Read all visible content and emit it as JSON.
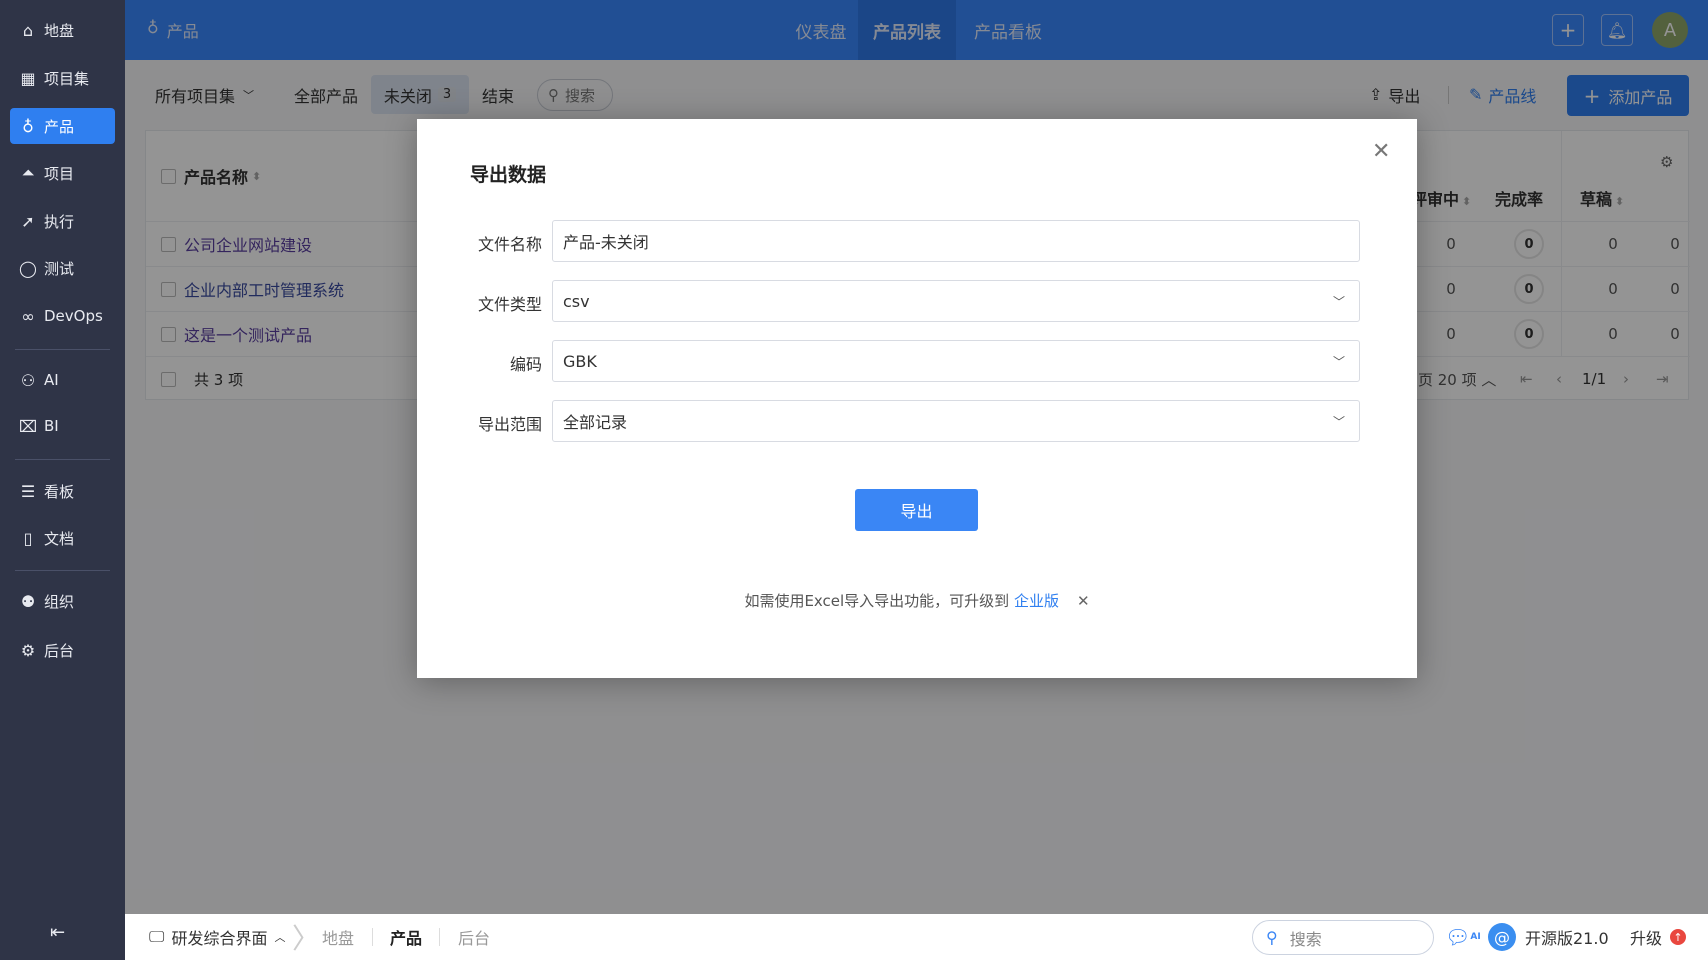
{
  "sidebar": {
    "items": [
      {
        "label": "地盘",
        "icon": "home-icon"
      },
      {
        "label": "项目集",
        "icon": "grid-icon"
      },
      {
        "label": "产品",
        "icon": "lightbulb-icon",
        "active": true
      },
      {
        "label": "项目",
        "icon": "rocket-icon"
      },
      {
        "label": "执行",
        "icon": "run-icon"
      },
      {
        "label": "测试",
        "icon": "test-icon"
      },
      {
        "label": "DevOps",
        "icon": "infinity-icon"
      },
      {
        "label": "AI",
        "icon": "robot-icon"
      },
      {
        "label": "BI",
        "icon": "chart-board-icon"
      },
      {
        "label": "看板",
        "icon": "kanban-icon"
      },
      {
        "label": "文档",
        "icon": "document-icon"
      },
      {
        "label": "组织",
        "icon": "users-icon"
      },
      {
        "label": "后台",
        "icon": "gear-icon"
      }
    ]
  },
  "topbar": {
    "breadcrumb": "产品",
    "nav": [
      {
        "label": "仪表盘"
      },
      {
        "label": "产品列表",
        "active": true
      },
      {
        "label": "产品看板"
      }
    ],
    "avatar": "A",
    "accent": "#3a88ff"
  },
  "toolbar": {
    "program_filter": "所有项目集",
    "tabs": [
      {
        "label": "全部产品"
      },
      {
        "label": "未关闭",
        "count": "3",
        "active": true
      },
      {
        "label": "结束"
      }
    ],
    "search": "搜索",
    "export": "导出",
    "product_line": "产品线",
    "add_product": "添加产品"
  },
  "table": {
    "headers": {
      "name": "产品名称",
      "reviewing": "评审中",
      "completion": "完成率",
      "draft": "草稿"
    },
    "rows": [
      {
        "name": "公司企业网站建设",
        "reviewing": "0",
        "completion": "0",
        "draft": "0",
        "last": "0"
      },
      {
        "name": "企业内部工时管理系统",
        "reviewing": "0",
        "completion": "0",
        "draft": "0",
        "last": "0"
      },
      {
        "name": "这是一个测试产品",
        "reviewing": "0",
        "completion": "0",
        "draft": "0",
        "last": "0"
      }
    ],
    "footer": {
      "total": "共 3 项",
      "per_page": "页 20 项",
      "page": "1/1"
    }
  },
  "modal": {
    "title": "导出数据",
    "fields": [
      {
        "label": "文件名称",
        "value": "产品-未关闭"
      },
      {
        "label": "文件类型",
        "value": "csv"
      },
      {
        "label": "编码",
        "value": "GBK"
      },
      {
        "label": "导出范围",
        "value": "全部记录"
      }
    ],
    "submit": "导出",
    "note": "如需使用Excel导入导出功能，可升级到",
    "note_link": "企业版"
  },
  "bottombar": {
    "app": "研发综合界面",
    "crumbs": [
      {
        "label": "地盘"
      },
      {
        "label": "产品",
        "active": true
      },
      {
        "label": "后台"
      }
    ],
    "search": "搜索",
    "ai": "AI",
    "version": "开源版21.0",
    "upgrade": "升级"
  }
}
